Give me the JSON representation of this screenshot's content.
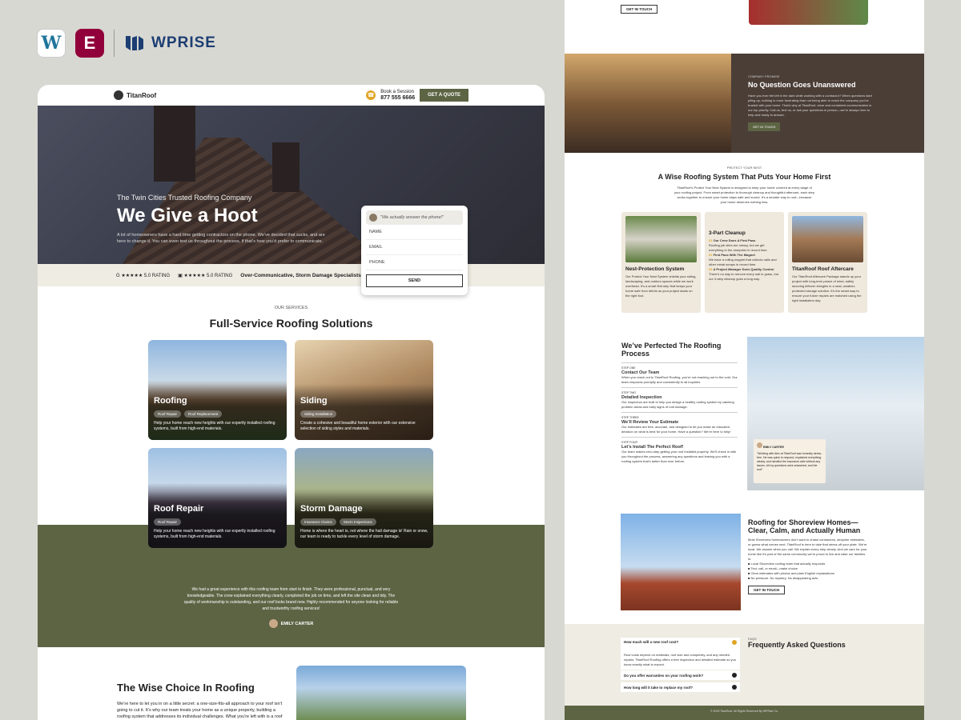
{
  "brand": {
    "wordpress_icon": "W",
    "elementor_icon": "E",
    "wprise": "WPRISE"
  },
  "site": {
    "logo": "TitanRoof",
    "book_line1": "Book a Session",
    "book_phone": "877 555 6666",
    "get_quote": "GET A QUOTE"
  },
  "hero": {
    "subtitle": "The Twin Cities Trusted Roofing Company",
    "title": "We Give a Hoot",
    "text": "A lot of homeowners have a hard time getting contractors on the phone. We’ve decided that sucks, and are here to change it. You can even text us throughout the process, if that’s how you’d prefer to communicate."
  },
  "strip": {
    "rating1": "5.0 RATING",
    "rating2": "5.0 RATING",
    "tagline": "Over-Communicative, Storm Damage Specialists & 3-Step Cleanup"
  },
  "form": {
    "quote": "\"We actually answer the phone!\"",
    "name": "NAME",
    "email": "EMAIL",
    "phone": "PHONE",
    "send": "SEND"
  },
  "services": {
    "label": "OUR SERVICES",
    "title": "Full-Service Roofing Solutions",
    "cards": [
      {
        "title": "Roofing",
        "tags": [
          "Roof Repair",
          "Roof Replacement"
        ],
        "text": "Help your home reach new heights with our expertly installed roofing systems, built from high-end materials."
      },
      {
        "title": "Siding",
        "tags": [
          "Siding Installation"
        ],
        "text": "Create a cohesive and beautiful home exterior with our extensive selection of siding styles and materials."
      },
      {
        "title": "Roof Repair",
        "tags": [
          "Roof Repair"
        ],
        "text": "Help your home reach new heights with our expertly installed roofing systems, built from high-end materials."
      },
      {
        "title": "Storm Damage",
        "tags": [
          "Insurance Claims",
          "Storm Inspections"
        ],
        "text": "Home is where the heart is, not where the hail damage is! Rain or snow, our team is ready to tackle every level of storm damage."
      }
    ]
  },
  "testimonial": {
    "text": "We had a great experience with this roofing team from start to finish. They were professional, punctual, and very knowledgeable. The crew explained everything clearly, completed the job on time, and left the site clean and tidy. The quality of workmanship is outstanding, and our roof looks brand new. Highly recommended for anyone looking for reliable and trustworthy roofing services!",
    "author": "EMILY CARTER"
  },
  "wise": {
    "title": "The Wise Choice In Roofing",
    "text": "We’re here to let you in on a little secret: a one-size-fits-all approach to your roof isn’t going to cut it. It’s why our team treats your home as a unique property, building a roofing system that addresses its individual challenges. What you’re left with is a roof that’s ready"
  },
  "right": {
    "get_in_touch": "GET IN TOUCH",
    "promise": {
      "label": "COMPANY PROMISE",
      "title": "No Question Goes Unanswered",
      "text": "Have you ever felt left in the dark while working with a contractor? When questions start piling up, nothing is more frustrating than not being able to reach the company you’ve trusted with your home. That’s why at TitanRoof, clear and consistent communication is our top priority. Call us, text us, or ask your questions in person—we’re always here to help and ready to answer.",
      "button": "GET IN TOUCH"
    },
    "system": {
      "label": "PROTECT YOUR NEST",
      "title": "A Wise Roofing System That Puts Your Home First",
      "text": "TitanRoof’s Protect Your Nest System is designed to keep your home covered at every stage of your roofing project. From smart protection to thorough cleanup and thoughtful aftercare, each step works together to ensure your home stays safe and sound. It’s a smarter way to roof—because your home deserves nothing less."
    },
    "cards": [
      {
        "title": "Nest-Protection System",
        "text": "Our Protect Your Nest System shields your siding, landscaping, and outdoor spaces while we work overhead. It’s a smart first step that keeps your home safe from debris as your project starts on the right foot."
      },
      {
        "title": "3-Part Cleanup",
        "items": [
          {
            "n": "01",
            "h": "Our Crew Does A First Pass",
            "t": "Roofing job sites are messy, but we get everything in the dumpster in record time."
          },
          {
            "n": "02",
            "h": "First Pass With The Magnet",
            "t": "We have a rolling magnet that collects nails and other metal scraps in record time."
          },
          {
            "n": "03",
            "h": "A Project Manager Does Quality Control",
            "t": "There’s no way to remove every nail in grass, but our 3-step cleanup goes a long way."
          }
        ]
      },
      {
        "title": "TitanRoof Roof Aftercare",
        "text": "Our TitanRoof Aftercare Package stands up your project with long-term peace of mind, safely securing leftover shingles in a neat, weather-protected storage solution. It’s the smart way to ensure your future repairs are matched using the right installation day."
      }
    ],
    "process": {
      "title": "We’ve Perfected The Roofing Process",
      "steps": [
        {
          "label": "STEP ONE",
          "title": "Contact Our Team",
          "text": "When you reach out to TitanRoof Roofing, you’re not reaching out to the void. Our team responds promptly and consistently to all inquiries."
        },
        {
          "label": "STEP TWO",
          "title": "Detailed Inspection",
          "text": "Our inspectors are built to help you design a healthy roofing system by catching problem areas and early signs of roof damage."
        },
        {
          "label": "STEP THREE",
          "title": "We’ll Review Your Estimate",
          "text": "Our estimates are free, accurate, and designed to let you make an educated decision on what is best for your home. Have a question? We’re here to help!"
        },
        {
          "label": "STEP FOUR",
          "title": "Let’s Install The Perfect Roof!",
          "text": "Our team makes zero-step getting your roof installed properly. We’ll check in with you throughout the process, answering any questions and leaving you with a roofing system that’s better than ever before."
        }
      ],
      "quote_author": "EMILY CARTER",
      "quote_text": "\"Working with Alex at TitanRoof was honestly stress-free. He was quick to respond, explained everything clearly, and handled the insurance side without any issues. All my questions were answered, and the roof\""
    },
    "shore": {
      "title": "Roofing for Shoreview Homes—Clear, Calm, and Actually Human",
      "text": "Most Shoreview homeowners don’t want to chase contractors, decipher estimates, or guess what comes next. TitanRoof is here to take that stress off your plate. We’re local. We answer when you call. We explain every step clearly. And we care for your home like it’s part of the same community we’re proud to live and raise our families in.",
      "bullets": [
        "Local Shoreview roofing team that actually responds",
        "Text, call, or email—make choice",
        "Clear estimates with photos and plain English explanations",
        "No pressure. No mystery. No disappearing acts"
      ],
      "button": "GET IN TOUCH"
    },
    "faq": {
      "label": "FAQS",
      "title": "Frequently Asked Questions",
      "items": [
        "How much will a new roof cost?",
        "Do you offer warranties on your roofing work?",
        "How long will it take to replace my roof?"
      ],
      "answer": "Roof costs depend on materials, roof size and complexity, and any needed repairs. TitanRoof Roofing offers a free inspection and detailed estimate so you know exactly what to expect."
    },
    "footer": "© 2025 TitanRoof. All Rights Reserved By WPRise Co."
  },
  "colors": {
    "olive": "#5d6444",
    "dark_brown": "#4b3e37",
    "cream": "#efece3",
    "accent_yellow": "#e0a526"
  }
}
